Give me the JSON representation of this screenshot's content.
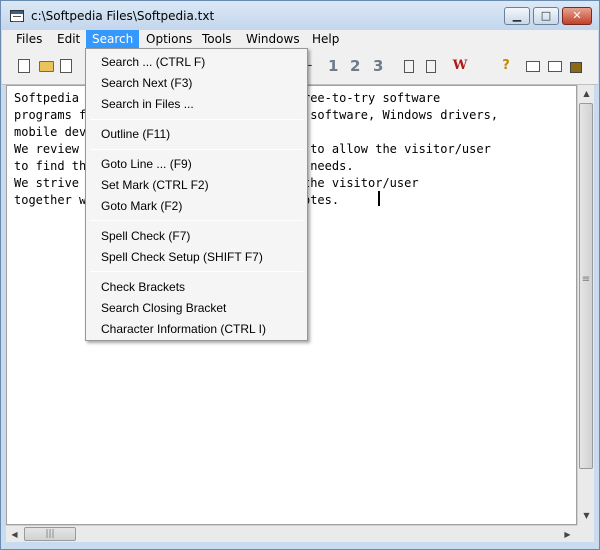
{
  "window": {
    "title": "c:\\Softpedia Files\\Softpedia.txt"
  },
  "menubar": {
    "items": [
      {
        "label": "Files"
      },
      {
        "label": "Edit"
      },
      {
        "label": "Search",
        "active": true
      },
      {
        "label": "Options"
      },
      {
        "label": "Tools"
      },
      {
        "label": "Windows"
      },
      {
        "label": "Help"
      }
    ]
  },
  "toolbar": {
    "numbers": [
      "1",
      "2",
      "3"
    ]
  },
  "editor": {
    "lines": [
      "Softpedia                          and free-to-try software",
      "programs f                         , Mac software, Windows drivers,",
      "mobile dev",
      "We review                          order to allow the visitor/user",
      "to find th                         ystem needs.",
      "We strive                          s to the visitor/user",
      "together w                         iew notes."
    ]
  },
  "search_menu": {
    "groups": [
      [
        "Search ... (CTRL F)",
        "Search Next (F3)",
        "Search in Files ..."
      ],
      [
        "Outline (F11)"
      ],
      [
        "Goto Line ... (F9)",
        "Set Mark (CTRL F2)",
        "Goto Mark (F2)"
      ],
      [
        "Spell Check (F7)",
        "Spell Check Setup (SHIFT F7)"
      ],
      [
        "Check Brackets",
        "Search Closing Bracket",
        "Character Information (CTRL I)"
      ]
    ]
  },
  "colors": {
    "menu_highlight": "#3399ff",
    "title_bar": "#c3d6ec",
    "close_button": "#c0412a"
  }
}
